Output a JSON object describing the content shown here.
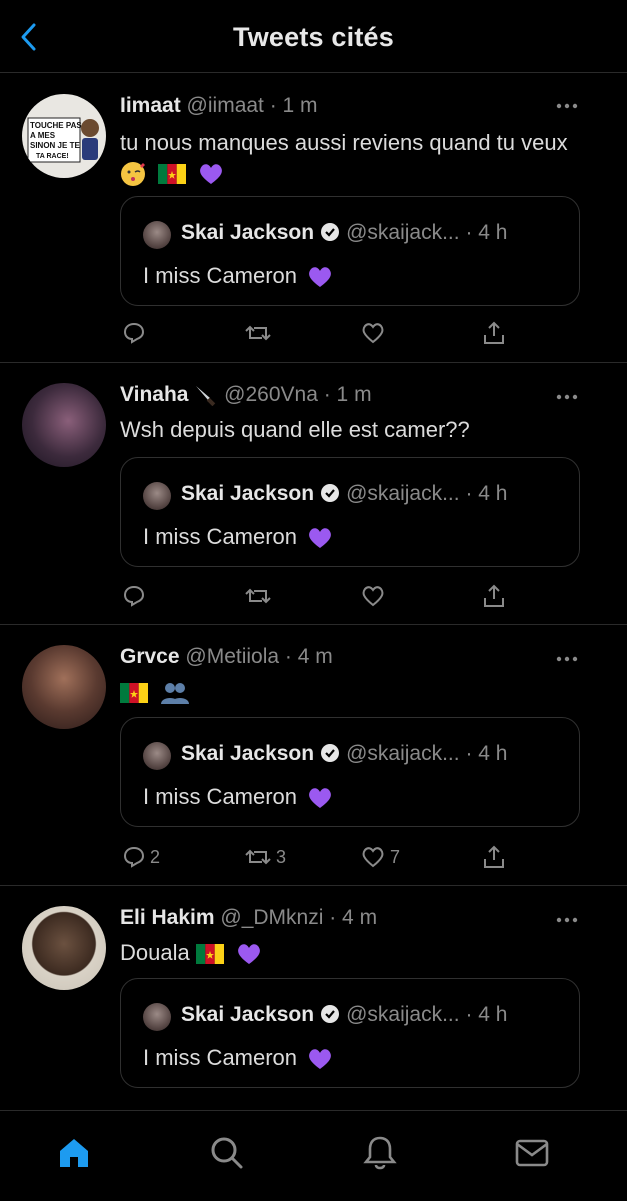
{
  "header": {
    "title": "Tweets cités"
  },
  "quoted": {
    "name": "Skai Jackson",
    "handle": "@skaijack...",
    "time": "· 4 h",
    "text": "I miss Cameron"
  },
  "tweets": [
    {
      "name": "Iimaat",
      "handle": "@iimaat · 1 m",
      "text": "tu nous manques aussi reviens quand tu veux",
      "avatar_text": [
        "TOUCHE PAS",
        "A MES 👟!!!",
        "SINON JE TE",
        "TA RACE!"
      ],
      "emojis": [
        "kiss-emoji",
        "cameroon-flag",
        "purple-heart"
      ],
      "counts": {
        "reply": "",
        "retweet": "",
        "like": ""
      }
    },
    {
      "name": "Vinaha",
      "handle": "@260Vna · 1 m",
      "text": "Wsh depuis quand elle est camer??",
      "emojis": [],
      "counts": {
        "reply": "",
        "retweet": "",
        "like": ""
      }
    },
    {
      "name": "Grvce",
      "handle": "@Metiiola · 4 m",
      "text": "",
      "emojis": [
        "cameroon-flag",
        "couple-silhouette"
      ],
      "counts": {
        "reply": "2",
        "retweet": "3",
        "like": "7"
      }
    },
    {
      "name": "Eli Hakim",
      "handle": "@_DMknzi · 4 m",
      "text": "Douala",
      "emojis": [
        "cameroon-flag",
        "purple-heart"
      ],
      "counts": {
        "reply": "",
        "retweet": "",
        "like": ""
      }
    }
  ],
  "icons": {
    "back": "chevron-left-icon",
    "home": "home-icon",
    "search": "search-icon",
    "notifications": "bell-icon",
    "messages": "mail-icon"
  },
  "colors": {
    "accent": "#1d9bf0",
    "background": "#000000",
    "heart": "#9b59f0",
    "secondary": "#8a8a8a"
  }
}
